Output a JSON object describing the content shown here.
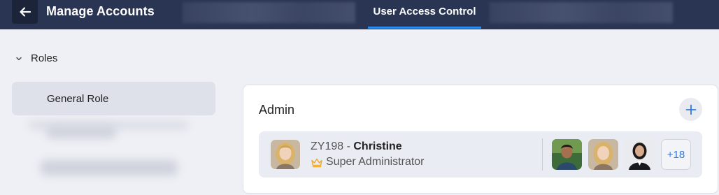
{
  "header": {
    "back_icon": "arrow-left-icon",
    "title": "Manage Accounts",
    "active_tab": "User Access Control"
  },
  "sidebar": {
    "section_label": "Roles",
    "section_icon": "chevron-down-icon",
    "items": [
      {
        "label": "General Role",
        "selected": true
      }
    ]
  },
  "card": {
    "title": "Admin",
    "add_icon": "plus-icon",
    "member": {
      "id": "ZY198",
      "separator": " - ",
      "name": "Christine",
      "role_icon": "crown-icon",
      "role": "Super Administrator"
    },
    "more_count": "+18"
  },
  "colors": {
    "header_bg": "#2a3554",
    "accent": "#2d8cf0",
    "crown": "#f0a830",
    "badge_text": "#2d7be0"
  }
}
